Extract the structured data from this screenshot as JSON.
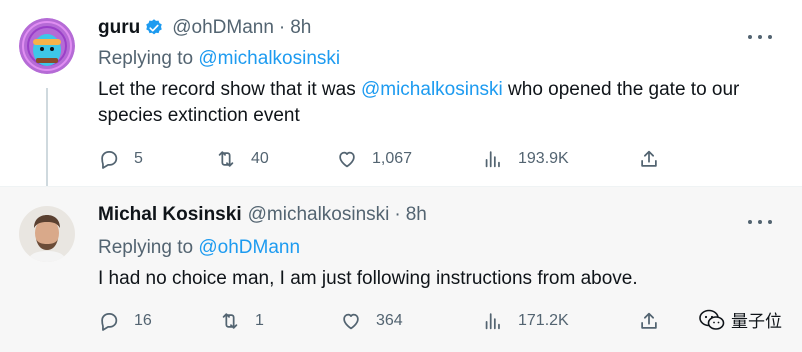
{
  "tweets": [
    {
      "name": "guru",
      "handle": "@ohDMann",
      "dot": "·",
      "time": "8h",
      "replying_prefix": "Replying to ",
      "replying_to": "@michalkosinski",
      "text_before": "Let the record show that it was ",
      "mention": "@michalkosinski",
      "text_after": " who opened the gate to our species extinction event",
      "replies": "5",
      "retweets": "40",
      "likes": "1,067",
      "views": "193.9K"
    },
    {
      "name": "Michal Kosinski",
      "handle": "@michalkosinski",
      "dot": "·",
      "time": "8h",
      "replying_prefix": "Replying to ",
      "replying_to": "@ohDMann",
      "text": "I had no choice man, I am just following instructions from above.",
      "replies": "16",
      "retweets": "1",
      "likes": "364",
      "views": "171.2K"
    }
  ],
  "watermark": {
    "label": "量子位"
  },
  "colors": {
    "link": "#1d9bf0",
    "muted": "#536471",
    "verified": "#1d9bf0"
  },
  "icons": [
    "verified-badge-icon",
    "more-icon",
    "reply-icon",
    "retweet-icon",
    "like-icon",
    "views-icon",
    "share-icon",
    "wechat-icon"
  ]
}
